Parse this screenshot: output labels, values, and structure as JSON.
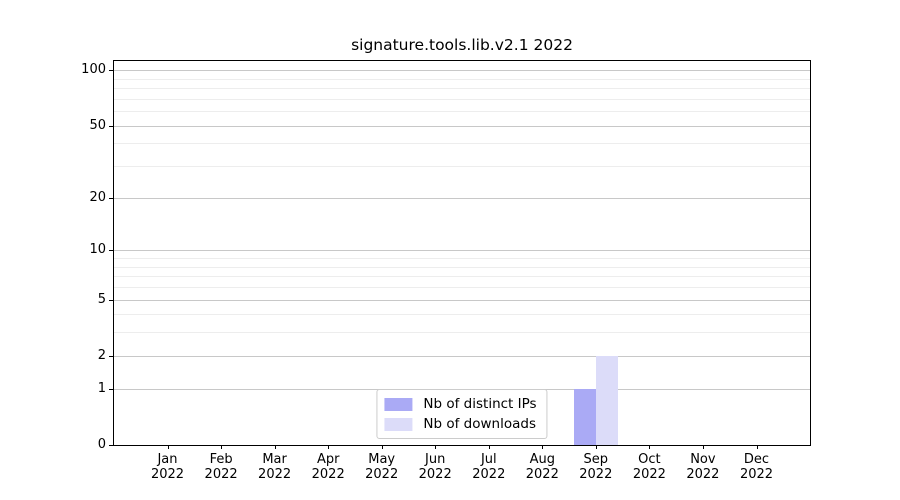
{
  "chart_data": {
    "type": "bar",
    "title": "signature.tools.lib.v2.1 2022",
    "x_categories": [
      {
        "month": "Jan",
        "year": "2022"
      },
      {
        "month": "Feb",
        "year": "2022"
      },
      {
        "month": "Mar",
        "year": "2022"
      },
      {
        "month": "Apr",
        "year": "2022"
      },
      {
        "month": "May",
        "year": "2022"
      },
      {
        "month": "Jun",
        "year": "2022"
      },
      {
        "month": "Jul",
        "year": "2022"
      },
      {
        "month": "Aug",
        "year": "2022"
      },
      {
        "month": "Sep",
        "year": "2022"
      },
      {
        "month": "Oct",
        "year": "2022"
      },
      {
        "month": "Nov",
        "year": "2022"
      },
      {
        "month": "Dec",
        "year": "2022"
      }
    ],
    "series": [
      {
        "name": "Nb of distinct IPs",
        "color": "#aaaaf5",
        "values": [
          0,
          0,
          0,
          0,
          0,
          0,
          0,
          0,
          1,
          0,
          0,
          0
        ]
      },
      {
        "name": "Nb of downloads",
        "color": "#dcdcf9",
        "values": [
          0,
          0,
          0,
          0,
          0,
          0,
          0,
          0,
          2,
          0,
          0,
          0
        ]
      }
    ],
    "yscale": "log1p",
    "ylim": [
      0,
      112
    ],
    "y_major_ticks": [
      0,
      1,
      2,
      5,
      10,
      20,
      50,
      100
    ],
    "y_minor_gridlines": [
      3,
      4,
      6,
      7,
      8,
      9,
      30,
      40,
      60,
      70,
      80,
      90
    ],
    "grid": true,
    "legend_position": "lower center",
    "colors": {
      "major_grid": "#c8c8c8",
      "minor_grid": "#ededed",
      "spine": "#000000",
      "text": "#000000"
    }
  }
}
